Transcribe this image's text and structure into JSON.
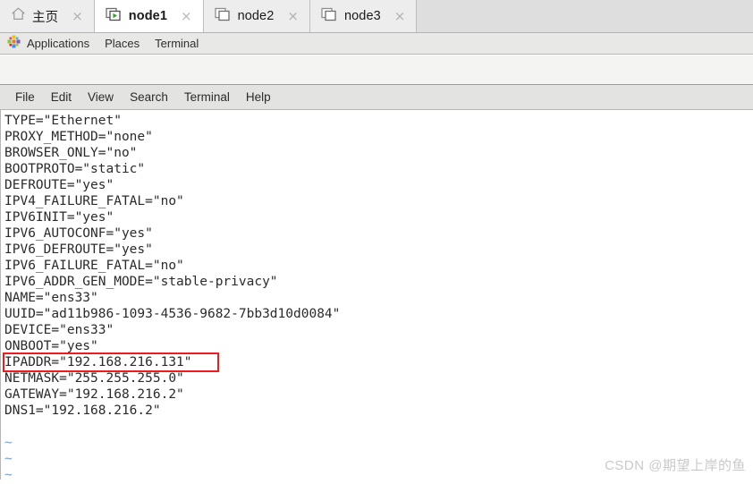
{
  "tabbar": {
    "tabs": [
      {
        "label": "主页",
        "icon": "home-icon",
        "active": false,
        "close": "×"
      },
      {
        "label": "node1",
        "icon": "terminal-session-running-icon",
        "active": true,
        "close": "×"
      },
      {
        "label": "node2",
        "icon": "terminal-session-icon",
        "active": false,
        "close": "×"
      },
      {
        "label": "node3",
        "icon": "terminal-session-icon",
        "active": false,
        "close": "×"
      }
    ]
  },
  "gnome_panel": {
    "apps_icon": "applications-icon",
    "items": [
      {
        "label": "Applications"
      },
      {
        "label": "Places"
      },
      {
        "label": "Terminal"
      }
    ]
  },
  "terminal_menubar": {
    "items": [
      {
        "label": "File"
      },
      {
        "label": "Edit"
      },
      {
        "label": "View"
      },
      {
        "label": "Search"
      },
      {
        "label": "Terminal"
      },
      {
        "label": "Help"
      }
    ]
  },
  "terminal": {
    "lines": [
      "TYPE=\"Ethernet\"",
      "PROXY_METHOD=\"none\"",
      "BROWSER_ONLY=\"no\"",
      "BOOTPROTO=\"static\"",
      "DEFROUTE=\"yes\"",
      "IPV4_FAILURE_FATAL=\"no\"",
      "IPV6INIT=\"yes\"",
      "IPV6_AUTOCONF=\"yes\"",
      "IPV6_DEFROUTE=\"yes\"",
      "IPV6_FAILURE_FATAL=\"no\"",
      "IPV6_ADDR_GEN_MODE=\"stable-privacy\"",
      "NAME=\"ens33\"",
      "UUID=\"ad11b986-1093-4536-9682-7bb3d10d0084\"",
      "DEVICE=\"ens33\"",
      "ONBOOT=\"yes\"",
      "IPADDR=\"192.168.216.131\"",
      "NETMASK=\"255.255.255.0\"",
      "GATEWAY=\"192.168.216.2\"",
      "DNS1=\"192.168.216.2\"",
      "",
      "~",
      "~",
      "~"
    ],
    "highlight": {
      "line_text": "IPADDR=\"192.168.216.131\"",
      "color": "#ee1c1c"
    }
  },
  "watermark": {
    "text": "CSDN @期望上岸的鱼"
  },
  "colors": {
    "annotation_red": "#ee1c1c",
    "tilde_blue": "#7a9bd4",
    "terminal_bg": "#ffffff",
    "terminal_fg": "#2b2b2b",
    "chrome_bg": "#dedede"
  }
}
